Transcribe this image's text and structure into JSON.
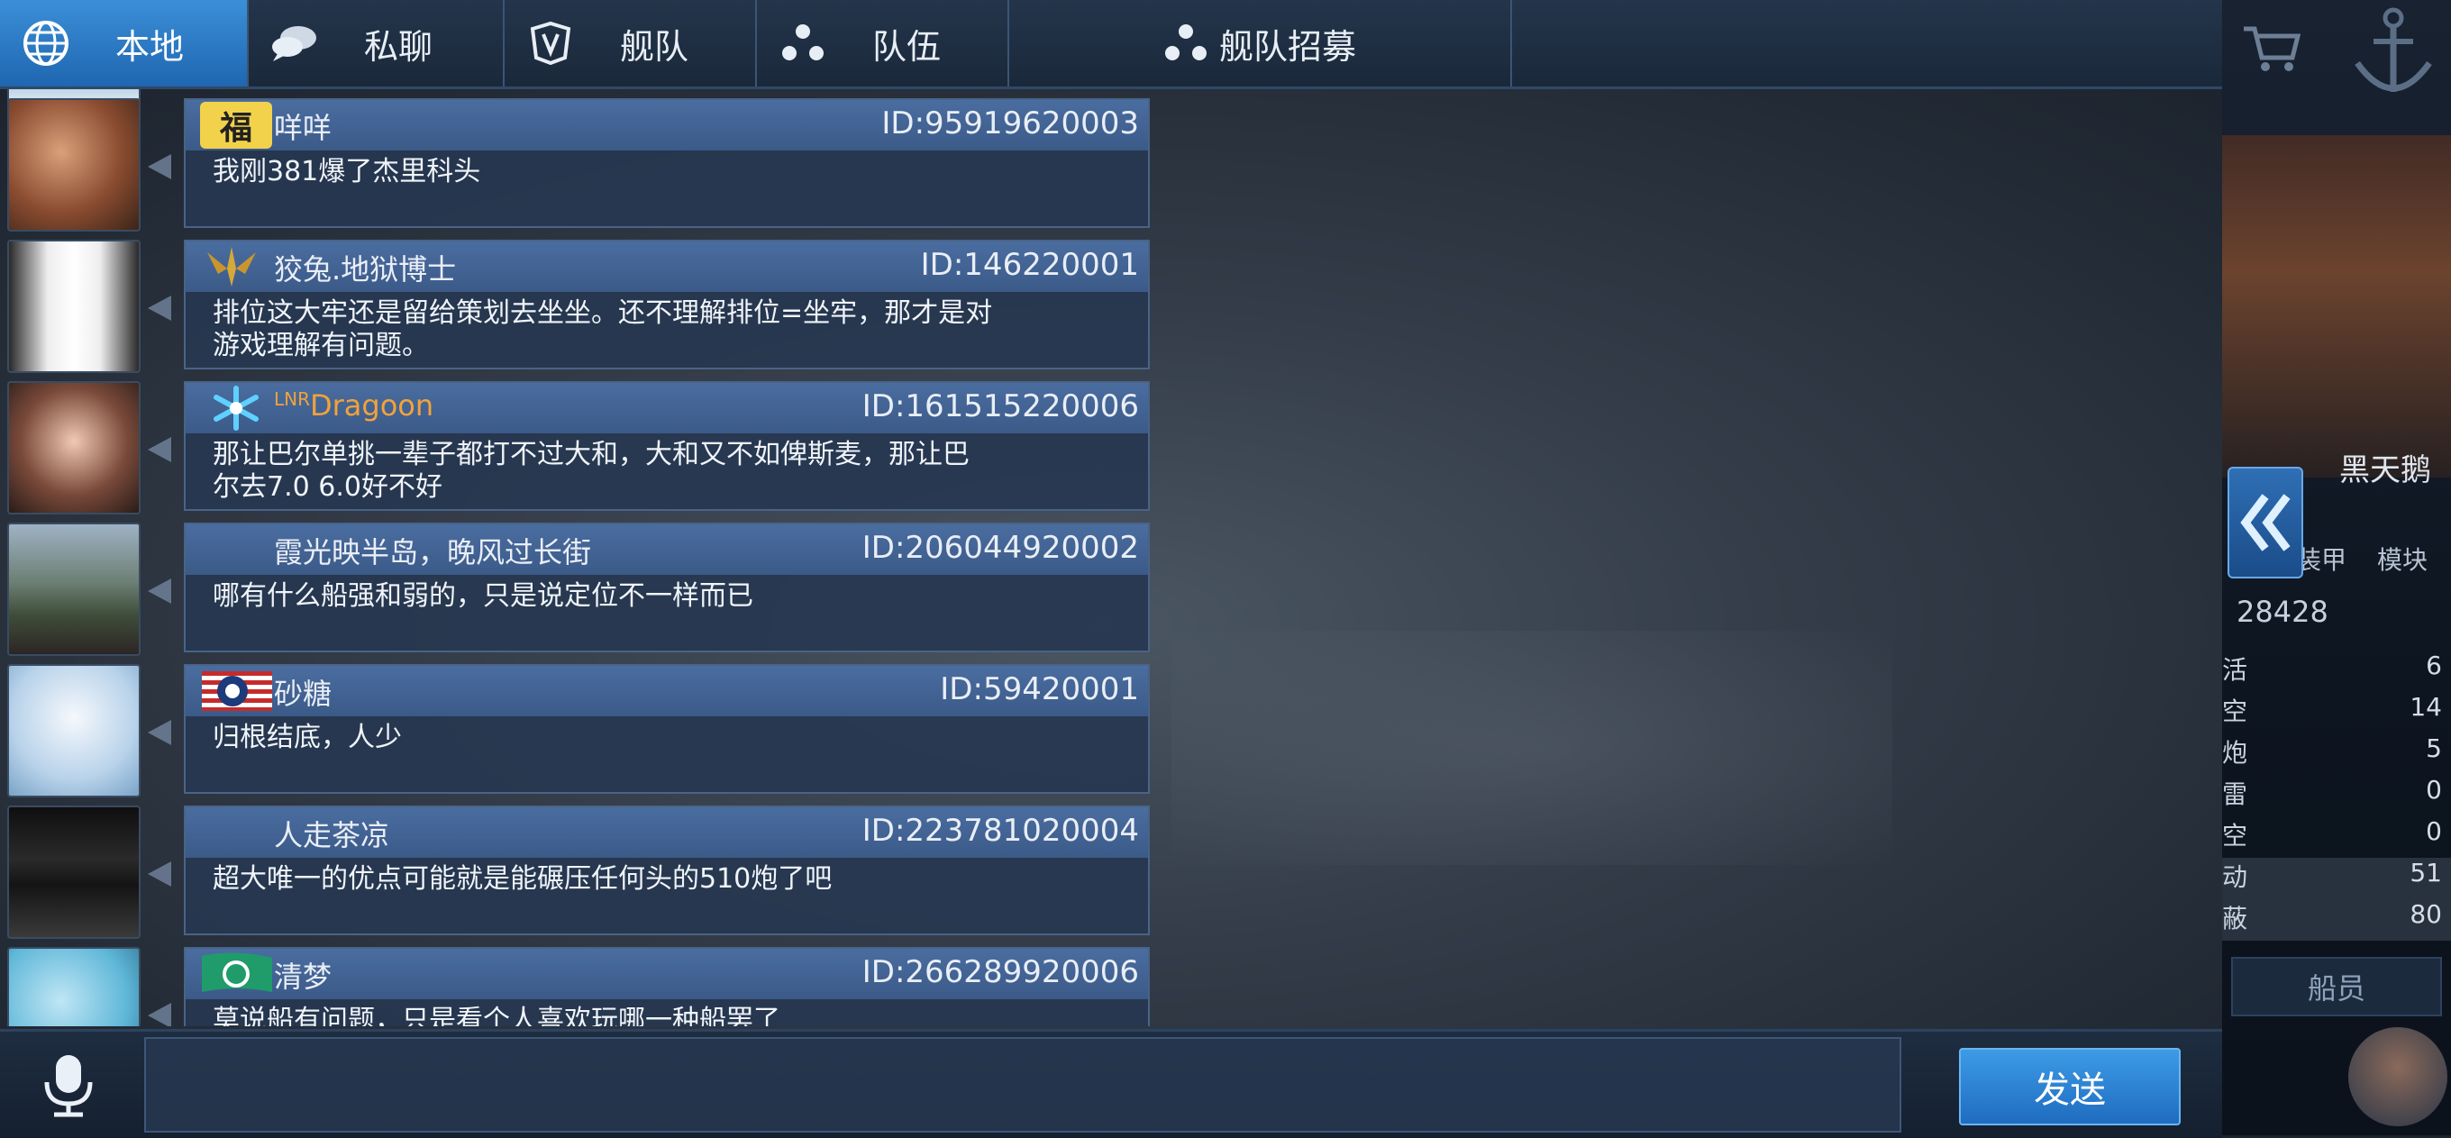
{
  "tabs": [
    {
      "label": "本地",
      "icon": "globe-icon",
      "active": true
    },
    {
      "label": "私聊",
      "icon": "speech-bubble-icon",
      "active": false
    },
    {
      "label": "舰队",
      "icon": "fleet-emblem-icon",
      "active": false
    },
    {
      "label": "队伍",
      "icon": "team-dots-icon",
      "active": false
    },
    {
      "label": "舰队招募",
      "icon": "team-dots-icon",
      "active": false
    }
  ],
  "messages": [
    {
      "name": "咩咩",
      "id": "ID:95919620003",
      "text": "我刚381爆了杰里科头",
      "badge": "福"
    },
    {
      "name": "狡兔.地狱博士",
      "id": "ID:146220001",
      "text": "排位这大牢还是留给策划去坐坐。还不理解排位=坐牢，那才是对\n游戏理解有问题。"
    },
    {
      "name": "Dragoon",
      "name_prefix": "LNR",
      "id": "ID:161515220006",
      "text": "那让巴尔单挑一辈子都打不过大和，大和又不如俾斯麦，那让巴\n尔去7.0 6.0好不好"
    },
    {
      "name": "霞光映半岛，晚风过长街",
      "id": "ID:206044920002",
      "text": "哪有什么船强和弱的，只是说定位不一样而已"
    },
    {
      "name": "砂糖",
      "id": "ID:59420001",
      "text": "归根结底，人少"
    },
    {
      "name": "人走茶凉",
      "id": "ID:223781020004",
      "text": "超大唯一的优点可能就是能碾压任何头的510炮了吧"
    },
    {
      "name": "清梦",
      "id": "ID:266289920006",
      "text": "莫说船有问题，只是看个人喜欢玩哪一种船罢了"
    }
  ],
  "input": {
    "value": ""
  },
  "send_label": "发送",
  "side_panel": {
    "ship_name": "黑天鹅",
    "tab_armor": "装甲",
    "tab_module": "模块",
    "power": "28428",
    "stats": [
      {
        "label": "活",
        "value": "6"
      },
      {
        "label": "空",
        "value": "14"
      },
      {
        "label": "炮",
        "value": "5"
      },
      {
        "label": "雷",
        "value": "0"
      },
      {
        "label": "空",
        "value": "0"
      },
      {
        "label": "动",
        "value": "51"
      },
      {
        "label": "蔽",
        "value": "80"
      }
    ],
    "crew_button": "船员"
  },
  "colors": {
    "accent": "#2f7fd0",
    "tab_active": "#3b8fd8",
    "bubble_head": "#4a6da0"
  }
}
